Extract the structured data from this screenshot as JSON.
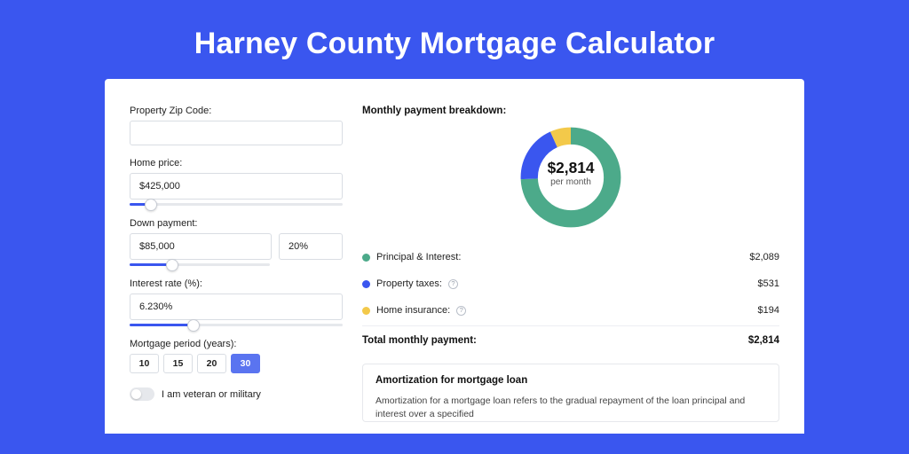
{
  "title": "Harney County Mortgage Calculator",
  "form": {
    "zip": {
      "label": "Property Zip Code:",
      "value": ""
    },
    "home_price": {
      "label": "Home price:",
      "value": "$425,000",
      "slider_pct": 10
    },
    "down_payment": {
      "label": "Down payment:",
      "amount": "$85,000",
      "percent": "20%",
      "slider_pct": 20
    },
    "interest_rate": {
      "label": "Interest rate (%):",
      "value": "6.230%",
      "slider_pct": 30
    },
    "period": {
      "label": "Mortgage period (years):",
      "options": [
        "10",
        "15",
        "20",
        "30"
      ],
      "selected": "30"
    },
    "veteran": {
      "label": "I am veteran or military",
      "checked": false
    }
  },
  "breakdown": {
    "title": "Monthly payment breakdown:",
    "center_amount": "$2,814",
    "center_caption": "per month",
    "items": [
      {
        "label": "Principal & Interest:",
        "value": "$2,089",
        "color": "green",
        "info": false
      },
      {
        "label": "Property taxes:",
        "value": "$531",
        "color": "blue",
        "info": true
      },
      {
        "label": "Home insurance:",
        "value": "$194",
        "color": "yellow",
        "info": true
      }
    ],
    "total_label": "Total monthly payment:",
    "total_value": "$2,814"
  },
  "chart_data": {
    "type": "pie",
    "title": "Monthly payment breakdown",
    "series": [
      {
        "name": "Principal & Interest",
        "value": 2089,
        "color": "#4caa8a"
      },
      {
        "name": "Property taxes",
        "value": 531,
        "color": "#3a56ef"
      },
      {
        "name": "Home insurance",
        "value": 194,
        "color": "#f3c94a"
      }
    ],
    "total": 2814,
    "center_label": "$2,814 per month"
  },
  "amortization": {
    "title": "Amortization for mortgage loan",
    "text": "Amortization for a mortgage loan refers to the gradual repayment of the loan principal and interest over a specified"
  }
}
